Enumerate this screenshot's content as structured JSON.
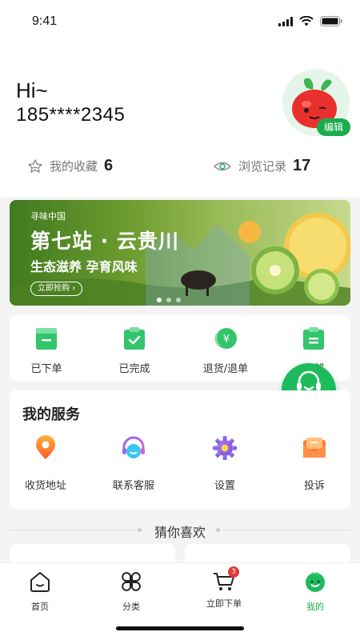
{
  "status": {
    "time": "9:41"
  },
  "profile": {
    "greeting": "Hi~",
    "phone": "185****2345",
    "edit_label": "编辑"
  },
  "stats": {
    "favorites": {
      "label": "我的收藏",
      "count": "6",
      "icon": "star-icon"
    },
    "history": {
      "label": "浏览记录",
      "count": "17",
      "icon": "eye-icon"
    }
  },
  "banner": {
    "brand": "寻味中国",
    "title": "第七站 · 云贵川",
    "subtitle": "生态滋养 孕育风味",
    "button": "立即抢购 ›",
    "slides": 3,
    "active_slide": 1
  },
  "orders": [
    {
      "label": "已下单",
      "icon": "order-placed-icon"
    },
    {
      "label": "已完成",
      "icon": "order-completed-icon"
    },
    {
      "label": "退货/退单",
      "icon": "refund-icon"
    },
    {
      "label": "全部",
      "icon": "all-orders-icon"
    }
  ],
  "cs_float": {
    "label": "客服"
  },
  "services": {
    "title": "我的服务",
    "items": [
      {
        "label": "收货地址",
        "icon": "location-pin-icon"
      },
      {
        "label": "联系客服",
        "icon": "headset-icon"
      },
      {
        "label": "设置",
        "icon": "gear-icon"
      },
      {
        "label": "投诉",
        "icon": "complaint-icon"
      }
    ]
  },
  "guess": {
    "title": "猜你喜欢"
  },
  "tabbar": {
    "items": [
      {
        "label": "首页",
        "icon": "home-icon"
      },
      {
        "label": "分类",
        "icon": "category-icon"
      },
      {
        "label": "立即下单",
        "icon": "cart-icon",
        "badge": "3"
      },
      {
        "label": "我的",
        "icon": "profile-icon",
        "active": true
      }
    ]
  },
  "colors": {
    "accent": "#1aac4f",
    "badge": "#e53935"
  }
}
